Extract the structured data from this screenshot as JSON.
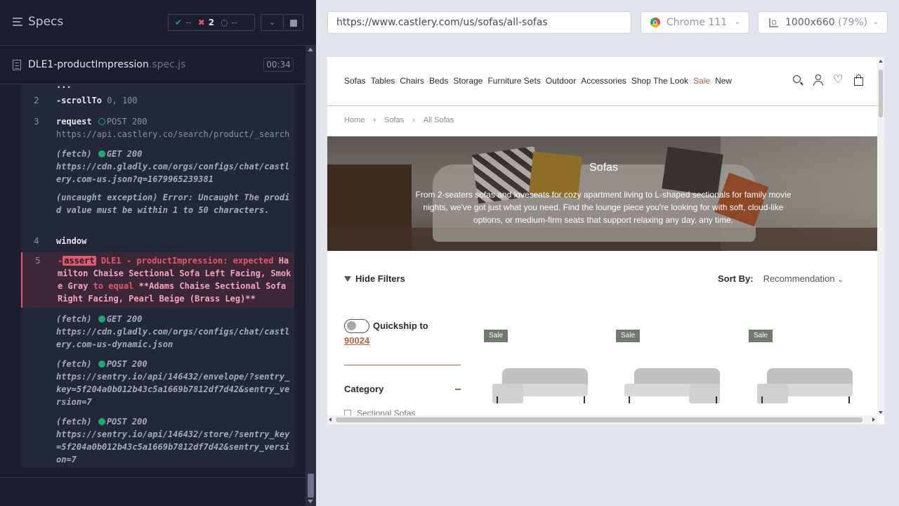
{
  "specs": {
    "title": "Specs",
    "passed": "--",
    "failed": "2",
    "pending": "--"
  },
  "spec": {
    "name": "DLE1-productImpression",
    "ext": ".spec.js",
    "duration": "00:34"
  },
  "log": {
    "cut": "...",
    "c2": {
      "num": "2",
      "name": "-scrollTo",
      "args": "0, 100"
    },
    "c3": {
      "num": "3",
      "name": "request",
      "method": "POST 200",
      "url": "https://api.castlery.co/search/product/_search"
    },
    "f1": {
      "label": "(fetch)",
      "method": "GET 200",
      "url": "https://cdn.gladly.com/orgs/configs/chat/castlery.com-us.json?q=1679965239381"
    },
    "ex": {
      "label": "(uncaught exception)",
      "msg": "Error: Uncaught The prodid value must be within 1 to 50 characters."
    },
    "c4": {
      "num": "4",
      "name": "window"
    },
    "c5": {
      "num": "5",
      "dash": "-",
      "tag": "assert",
      "p1": "DLE1 - productImpression: expected",
      "actual": "Hamilton Chaise Sectional Sofa Left Facing, Smoke Gray",
      "mid": "to equal",
      "expected": "**Adams Chaise Sectional Sofa Right Facing, Pearl Beige (Brass Leg)**"
    },
    "f2": {
      "label": "(fetch)",
      "method": "GET 200",
      "url": "https://cdn.gladly.com/orgs/configs/chat/castlery.com-us-dynamic.json"
    },
    "f3": {
      "label": "(fetch)",
      "method": "POST 200",
      "url": "https://sentry.io/api/146432/envelope/?sentry_key=5f204a0b012b43c5a1669b7812df7d42&sentry_version=7"
    },
    "f4": {
      "label": "(fetch)",
      "method": "POST 200",
      "url": "https://sentry.io/api/146432/store/?sentry_key=5f204a0b012b43c5a1669b7812df7d42&sentry_version=7"
    }
  },
  "toolbar": {
    "url": "https://www.castlery.com/us/sofas/all-sofas",
    "browser": "Chrome 111",
    "viewport": "1000x660",
    "scale": "(79%)"
  },
  "site": {
    "nav": [
      "Sofas",
      "Tables",
      "Chairs",
      "Beds",
      "Storage",
      "Furniture Sets",
      "Outdoor",
      "Accessories",
      "Shop The Look",
      "Sale",
      "New"
    ],
    "breadcrumb": [
      "Home",
      "Sofas",
      "All Sofas"
    ],
    "sep": "›",
    "hero_title": "Sofas",
    "hero_text": "From 2-seaters sofas and loveseats for cozy apartment living to L-shaped sectionals for family movie nights, we've got just what you need. Find the lounge piece you're looking for with soft, cloud-like options, or medium-firm seats that support relaxing any day, any time.",
    "hide_filters": "Hide Filters",
    "sort_label": "Sort By:",
    "sort_value": "Recommendation",
    "quickship": "Quickship to",
    "zip": "90024",
    "category": "Category",
    "cat_item": "Sectional Sofas",
    "badge": "Sale"
  },
  "icons": {
    "chevron": "chevron-down-icon",
    "heart": "♡"
  },
  "colors": {
    "fail": "#e45770",
    "pass": "#1fa971",
    "accent": "#b4623e"
  }
}
